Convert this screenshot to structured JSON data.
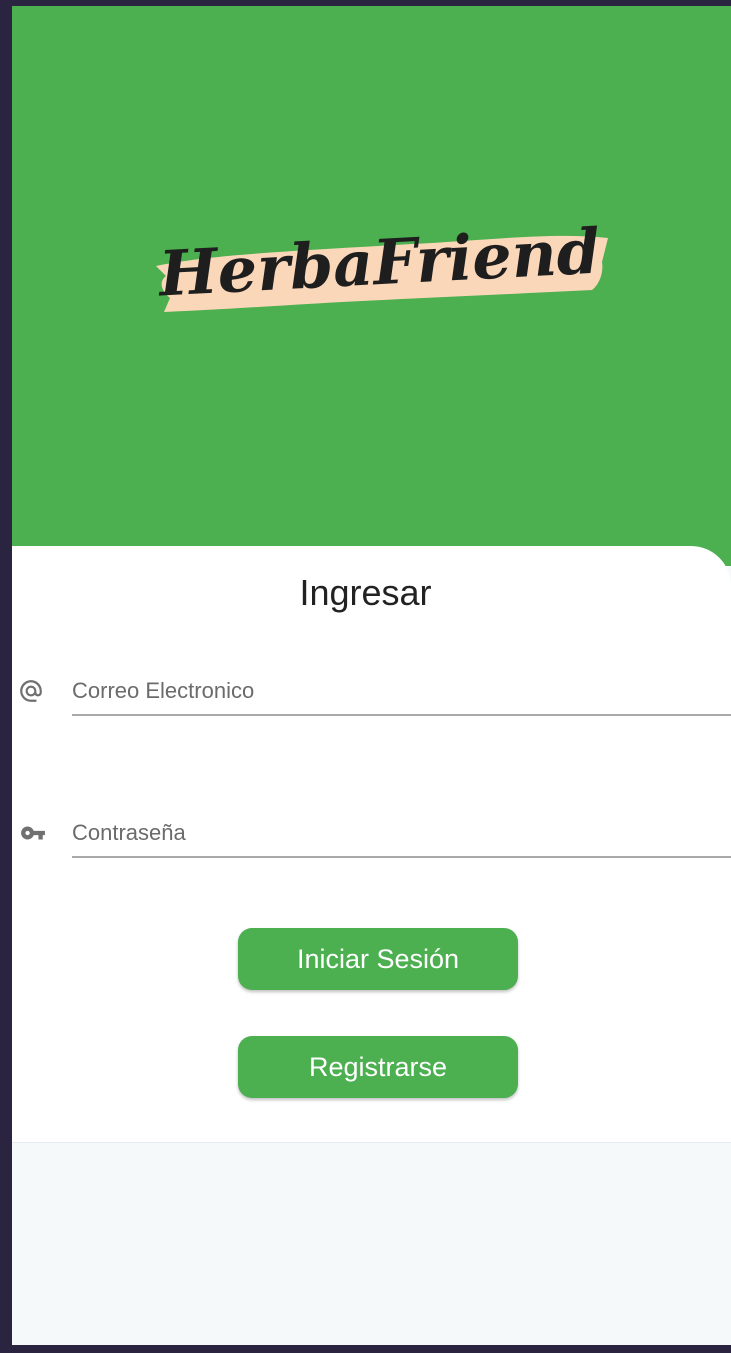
{
  "app": {
    "logo_text": "HerbaFriend"
  },
  "login": {
    "title": "Ingresar",
    "email_placeholder": "Correo Electronico",
    "email_icon": "at-icon",
    "password_placeholder": "Contraseña",
    "password_icon": "key-icon",
    "login_label": "Iniciar Sesión",
    "register_label": "Registrarse"
  },
  "colors": {
    "primary": "#4caf50",
    "logo_brush": "#fbd7b9",
    "logo_text": "#1e1e1e",
    "card_background": "#ffffff",
    "page_background": "#f6f9f9"
  }
}
